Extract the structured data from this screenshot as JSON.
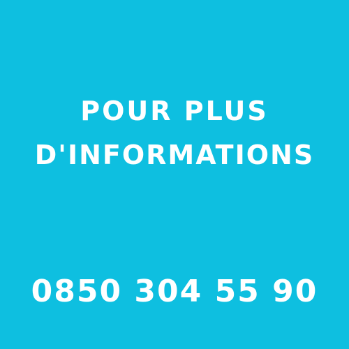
{
  "background_color": "#0ebfe0",
  "text_color": "#ffffff",
  "headline": {
    "line1": "POUR PLUS",
    "line2": "D'INFORMATIONS"
  },
  "phone": "0850 304 55 90"
}
